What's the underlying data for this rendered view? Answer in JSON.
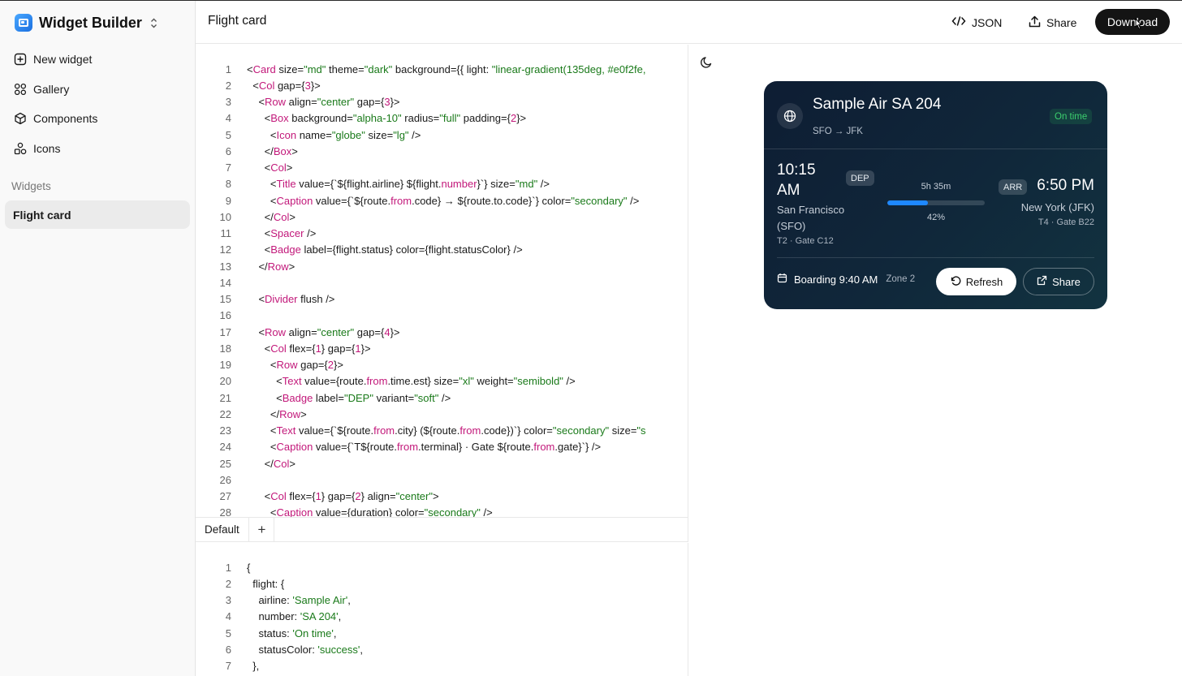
{
  "app": {
    "title": "Widget Builder"
  },
  "sidebar": {
    "items": [
      {
        "label": "New widget",
        "icon": "plus-square-icon"
      },
      {
        "label": "Gallery",
        "icon": "grid-icon"
      },
      {
        "label": "Components",
        "icon": "cube-icon"
      },
      {
        "label": "Icons",
        "icon": "shapes-icon"
      }
    ],
    "section_label": "Widgets",
    "active_widget": "Flight card"
  },
  "header": {
    "title": "Flight card",
    "json_label": "JSON",
    "share_label": "Share",
    "download_label": "Download"
  },
  "editor": {
    "lines": [
      "<Card size=\"md\" theme=\"dark\" background={{ light: \"linear-gradient(135deg, #e0f2fe,",
      "  <Col gap={3}>",
      "    <Row align=\"center\" gap={3}>",
      "      <Box background=\"alpha-10\" radius=\"full\" padding={2}>",
      "        <Icon name=\"globe\" size=\"lg\" />",
      "      </Box>",
      "      <Col>",
      "        <Title value={`${flight.airline} ${flight.number}`} size=\"md\" />",
      "        <Caption value={`${route.from.code} → ${route.to.code}`} color=\"secondary\" />",
      "      </Col>",
      "      <Spacer />",
      "      <Badge label={flight.status} color={flight.statusColor} />",
      "    </Row>",
      "",
      "    <Divider flush />",
      "",
      "    <Row align=\"center\" gap={4}>",
      "      <Col flex={1} gap={1}>",
      "        <Row gap={2}>",
      "          <Text value={route.from.time.est} size=\"xl\" weight=\"semibold\" />",
      "          <Badge label=\"DEP\" variant=\"soft\" />",
      "        </Row>",
      "        <Text value={`${route.from.city} (${route.from.code})`} color=\"secondary\" size=\"s",
      "        <Caption value={`T${route.from.terminal} · Gate ${route.from.gate}`} />",
      "      </Col>",
      "",
      "      <Col flex={1} gap={2} align=\"center\">",
      "        <Caption value={duration} color=\"secondary\" />"
    ]
  },
  "data_tabs": {
    "default_label": "Default",
    "add_label": "+"
  },
  "data_editor": {
    "lines": [
      "{",
      "  flight: {",
      "    airline: 'Sample Air',",
      "    number: 'SA 204',",
      "    status: 'On time',",
      "    statusColor: 'success',",
      "  },"
    ]
  },
  "card": {
    "title": "Sample Air SA 204",
    "route": "SFO → JFK",
    "status": "On time",
    "status_color": "#3ccf6e",
    "dep_time": "10:15 AM",
    "dep_badge": "DEP",
    "dep_city": "San Francisco (SFO)",
    "dep_gate": "T2 · Gate C12",
    "duration": "5h 35m",
    "progress_pct": 42,
    "progress_label": "42%",
    "arr_badge": "ARR",
    "arr_time": "6:50 PM",
    "arr_city": "New York (JFK)",
    "arr_gate": "T4 · Gate B22",
    "boarding": "Boarding 9:40 AM",
    "zone": "Zone 2",
    "refresh_label": "Refresh",
    "share_label": "Share",
    "accent": "#1e88ff"
  }
}
